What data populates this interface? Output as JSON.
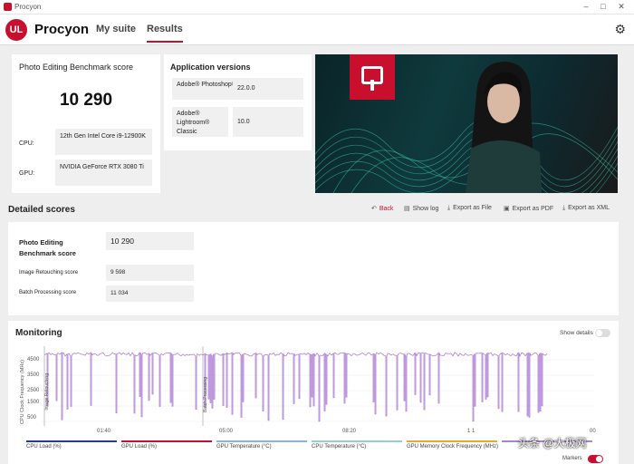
{
  "window": {
    "title": "Procyon"
  },
  "header": {
    "logo": "UL",
    "brand": "Procyon",
    "nav": [
      "My suite",
      "Results"
    ],
    "settings_icon": "gear-icon"
  },
  "score_card": {
    "title": "Photo Editing Benchmark score",
    "score": "10 290",
    "cpu_label": "CPU:",
    "cpu_value": "12th Gen Intel Core i9-12900K",
    "gpu_label": "GPU:",
    "gpu_value": "NVIDIA GeForce RTX 3080 Ti"
  },
  "app_versions": {
    "title": "Application versions",
    "apps": [
      {
        "name": "Adobe® Photoshop®",
        "version": "22.0.0"
      },
      {
        "name": "Adobe® Lightroom® Classic",
        "version": "10.0"
      }
    ]
  },
  "detailed": {
    "title": "Detailed scores",
    "toolbar": {
      "back": "Back",
      "show_log": "Show log",
      "export_file": "Export as File",
      "export_pdf": "Export as PDF",
      "export_xml": "Export as XML"
    },
    "main_label": "Photo Editing Benchmark score",
    "main_value": "10 290",
    "rows": [
      {
        "label": "Image Retouching score",
        "value": "9 598"
      },
      {
        "label": "Batch Processing score",
        "value": "11 034"
      }
    ]
  },
  "monitoring": {
    "title": "Monitoring",
    "show_details": "Show details",
    "y_axis_label": "CPU Clock Frequency (MHz)",
    "y_ticks": [
      "4500",
      "3500",
      "2500",
      "1500",
      "500"
    ],
    "x_ticks": [
      "01:40",
      "05:00",
      "08:20",
      "1 1",
      "00"
    ],
    "markers": [
      "Image Retouching",
      "Batch Processing"
    ],
    "legend": [
      {
        "label": "CPU Load (%)",
        "color": "#1f3f8f"
      },
      {
        "label": "GPU Load (%)",
        "color": "#c8102e"
      },
      {
        "label": "GPU Temperature (°C)",
        "color": "#7fb8e6"
      },
      {
        "label": "CPU Temperature (°C)",
        "color": "#8fd3c8"
      },
      {
        "label": "GPU Memory Clock Frequency (MHz)",
        "color": "#e8a82b"
      },
      {
        "label": "",
        "color": "#b07fd8"
      }
    ],
    "markers_label": "Markers",
    "series_color": "#b07fd8"
  },
  "watermark": "头条 @大极网"
}
